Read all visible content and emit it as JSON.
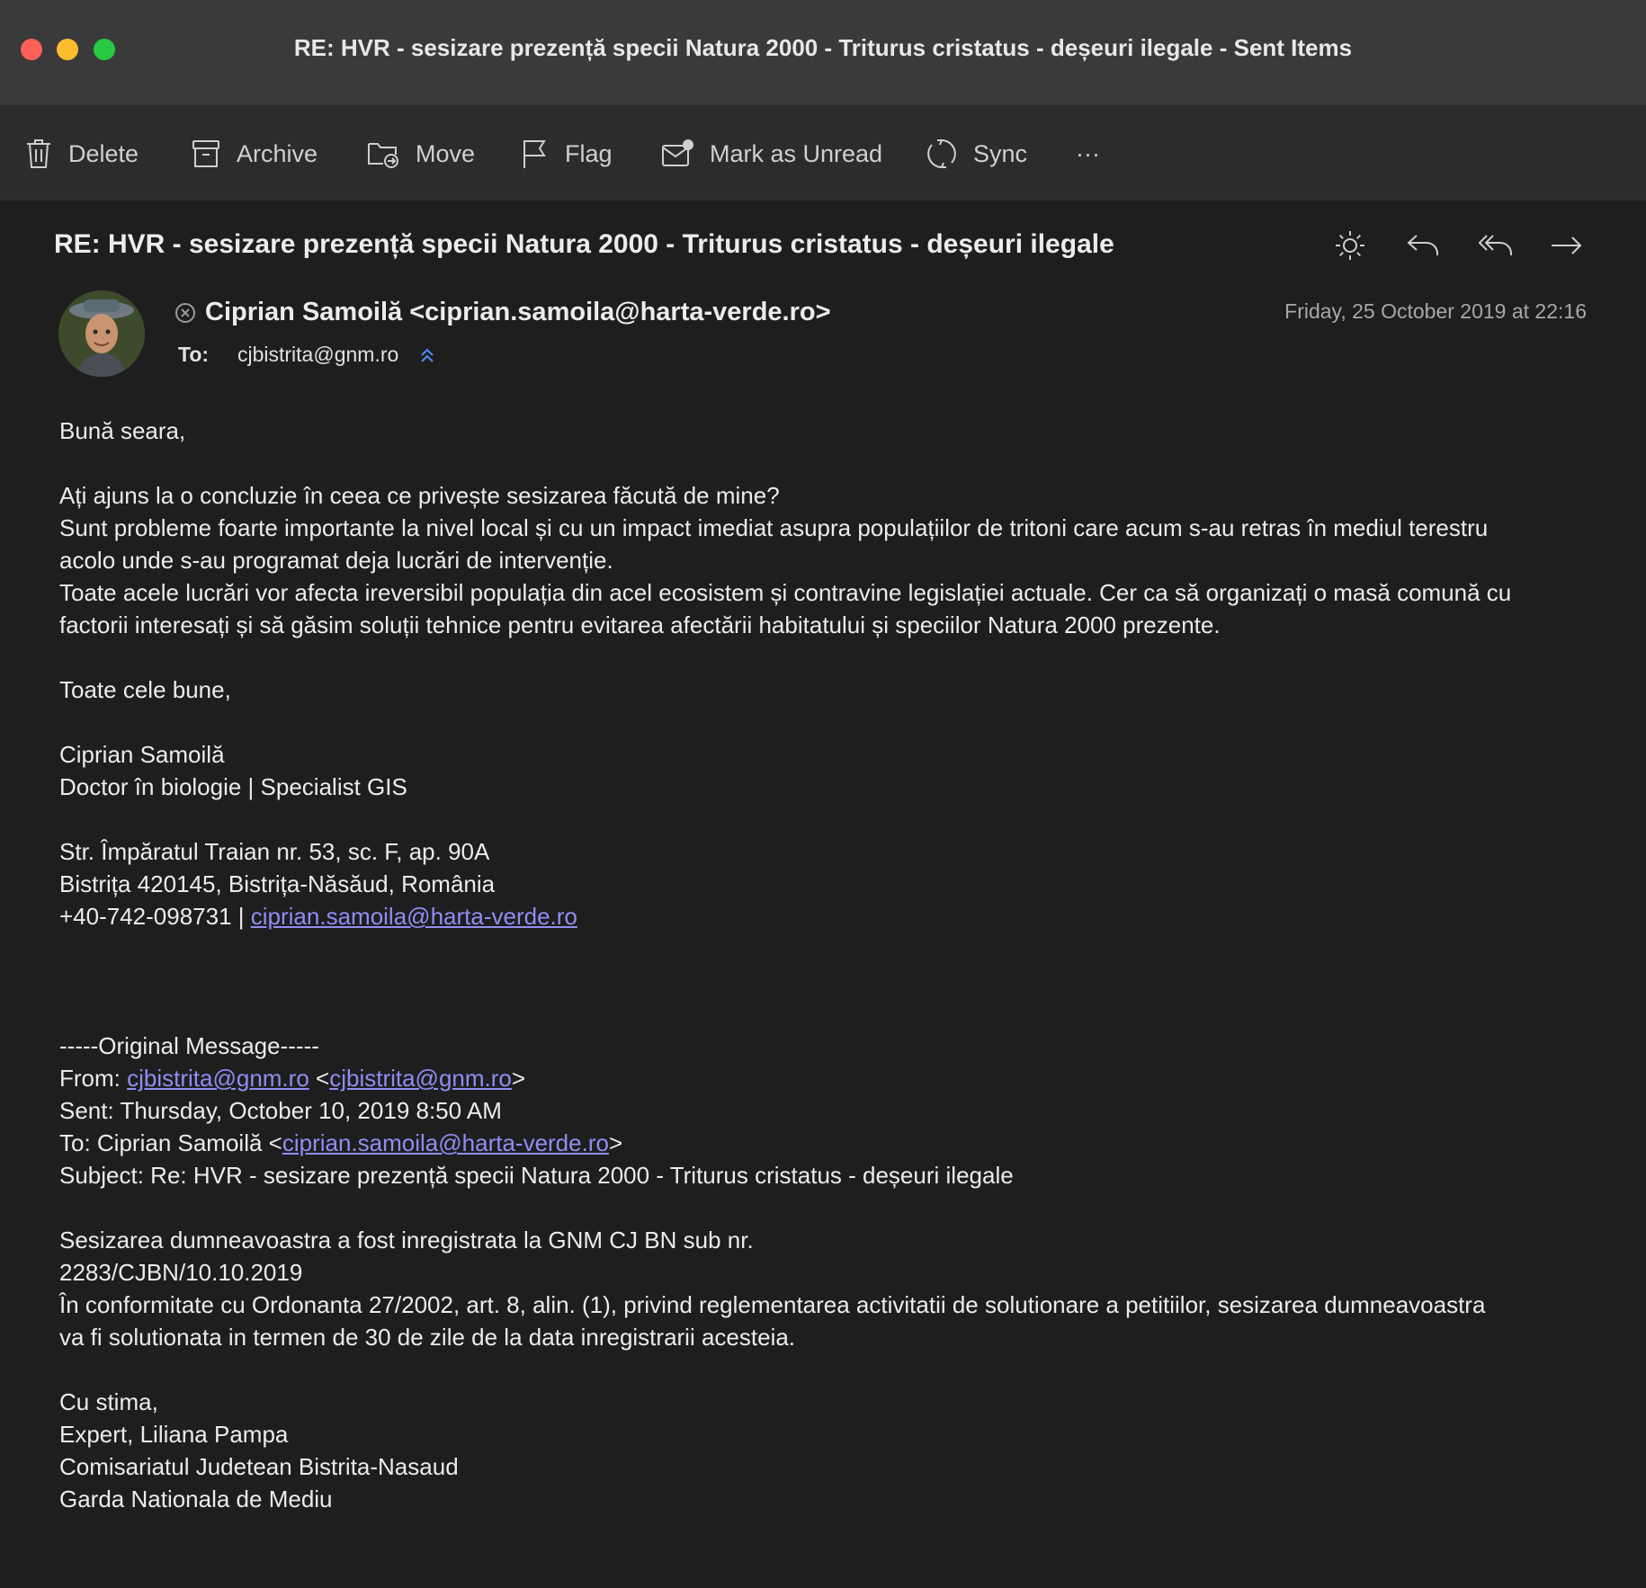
{
  "window": {
    "title": "RE: HVR - sesizare prezență specii Natura 2000 - Triturus cristatus - deșeuri ilegale - Sent Items"
  },
  "toolbar": {
    "delete": "Delete",
    "archive": "Archive",
    "move": "Move",
    "flag": "Flag",
    "mark_unread": "Mark as Unread",
    "sync": "Sync",
    "more": "···"
  },
  "message": {
    "subject": "RE: HVR - sesizare prezență specii Natura 2000 - Triturus cristatus - deșeuri ilegale",
    "sender": "Ciprian Samoilă <ciprian.samoila@harta-verde.ro>",
    "to_label": "To:",
    "to": "cjbistrita@gnm.ro",
    "date": "Friday, 25 October 2019 at 22:16",
    "icons": [
      "sun-icon",
      "reply-icon",
      "reply-all-icon",
      "forward-icon"
    ]
  },
  "body": {
    "greeting": "Bună seara,",
    "p1": "Ați ajuns la o concluzie în ceea ce privește sesizarea făcută de mine?",
    "p2a": "Sunt probleme foarte importante la nivel local și cu un impact imediat asupra populațiilor de tritoni care acum s-au retras în mediul terestru",
    "p2b": "acolo unde s-au programat deja lucrări de intervenție.",
    "p3a": "Toate acele lucrări vor afecta ireversibil populația din acel ecosistem și contravine legislației actuale. Cer ca să organizați o masă comună cu",
    "p3b": "factorii interesați și să găsim soluții tehnice pentru evitarea afectării habitatului și speciilor Natura 2000 prezente.",
    "closing": "Toate cele bune,",
    "sig_name": "Ciprian Samoilă",
    "sig_title": "Doctor în biologie | Specialist GIS",
    "sig_addr1": "Str. Împăratul Traian nr. 53, sc. F, ap. 90A",
    "sig_addr2": "Bistrița 420145, Bistrița-Năsăud, România",
    "sig_phone": "+40-742-098731 | ",
    "sig_email": "ciprian.samoila@harta-verde.ro",
    "orig_header": "-----Original Message-----",
    "from_label": "From: ",
    "from_link1": "cjbistrita@gnm.ro",
    "from_mid": " <",
    "from_link2": "cjbistrita@gnm.ro",
    "from_end": ">",
    "sent": "Sent: Thursday, October 10, 2019 8:50 AM",
    "to_prefix": "To: Ciprian Samoilă <",
    "to_link": "ciprian.samoila@harta-verde.ro",
    "to_end": ">",
    "orig_subject": "Subject: Re: HVR - sesizare prezență specii Natura 2000 - Triturus cristatus - deșeuri ilegale",
    "o1": "Sesizarea dumneavoastra a fost inregistrata la GNM CJ BN sub nr.",
    "o2": "2283/CJBN/10.10.2019",
    "o3a": "În conformitate cu Ordonanta 27/2002, art. 8, alin. (1), privind reglementarea activitatii de solutionare a petitiilor, sesizarea dumneavoastra",
    "o3b": "va fi solutionata in termen de 30 de zile de la data inregistrarii acesteia.",
    "o_closing": "Cu stima,",
    "o_sig1": "Expert, Liliana Pampa",
    "o_sig2": "Comisariatul Judetean Bistrita-Nasaud",
    "o_sig3": "Garda Nationala de Mediu"
  }
}
